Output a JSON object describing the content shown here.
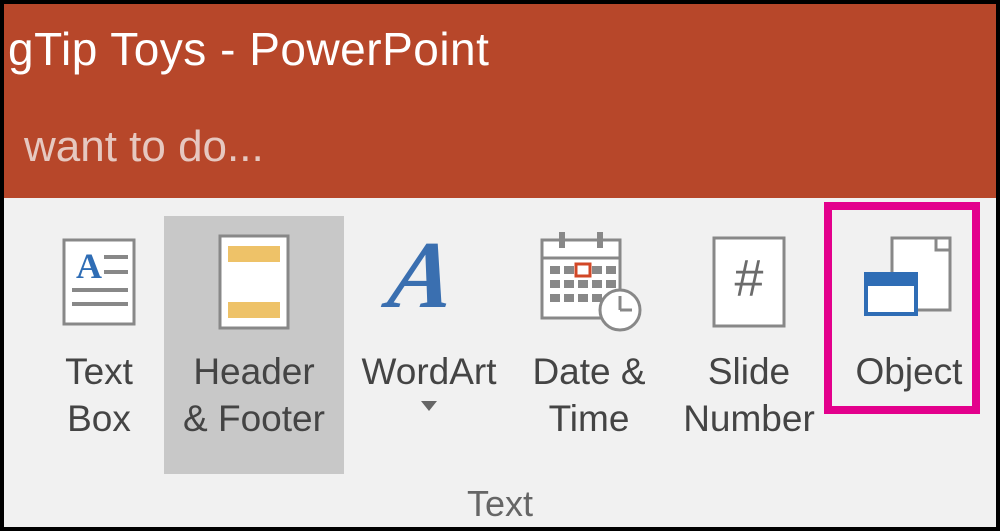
{
  "titlebar": {
    "text": "gTip Toys - PowerPoint"
  },
  "tellme": {
    "placeholder": "want to do..."
  },
  "ribbon": {
    "groupLabel": "Text",
    "buttons": {
      "textbox": {
        "line1": "Text",
        "line2": "Box"
      },
      "headerfooter": {
        "line1": "Header",
        "line2": "& Footer"
      },
      "wordart": {
        "line1": "WordArt"
      },
      "datetime": {
        "line1": "Date &",
        "line2": "Time"
      },
      "slidenum": {
        "line1": "Slide",
        "line2": "Number"
      },
      "object": {
        "line1": "Object"
      }
    }
  },
  "icons": {
    "textbox": "textbox-icon",
    "headerfooter": "header-footer-icon",
    "wordart": "wordart-icon",
    "datetime": "date-time-icon",
    "slidenum": "slide-number-icon",
    "object": "object-icon"
  }
}
